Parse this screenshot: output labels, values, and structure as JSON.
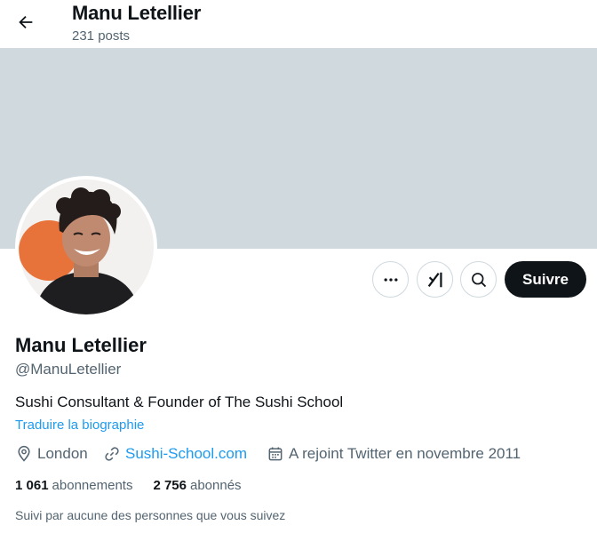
{
  "header": {
    "name": "Manu Letellier",
    "posts": "231 posts"
  },
  "profile": {
    "name": "Manu Letellier",
    "handle": "@ManuLetellier",
    "bio": "Sushi Consultant & Founder of The Sushi School",
    "translate": "Traduire la biographie",
    "location": "London",
    "website": "Sushi-School.com",
    "joined": "A rejoint Twitter en novembre 2011",
    "following_count": "1 061",
    "following_label": "abonnements",
    "followers_count": "2 756",
    "followers_label": "abonnés",
    "followed_by": "Suivi par aucune des personnes que vous suivez"
  },
  "actions": {
    "follow": "Suivre"
  },
  "icons": {
    "back": "arrow-left-icon",
    "more": "more-dots-icon",
    "grok": "grok-icon",
    "search": "search-icon",
    "location": "location-pin-icon",
    "link": "link-icon",
    "calendar": "calendar-icon"
  },
  "colors": {
    "accent": "#1d9bf0",
    "banner": "#cfd9de",
    "follow_button": "#0f1419",
    "secondary_text": "#536471"
  }
}
